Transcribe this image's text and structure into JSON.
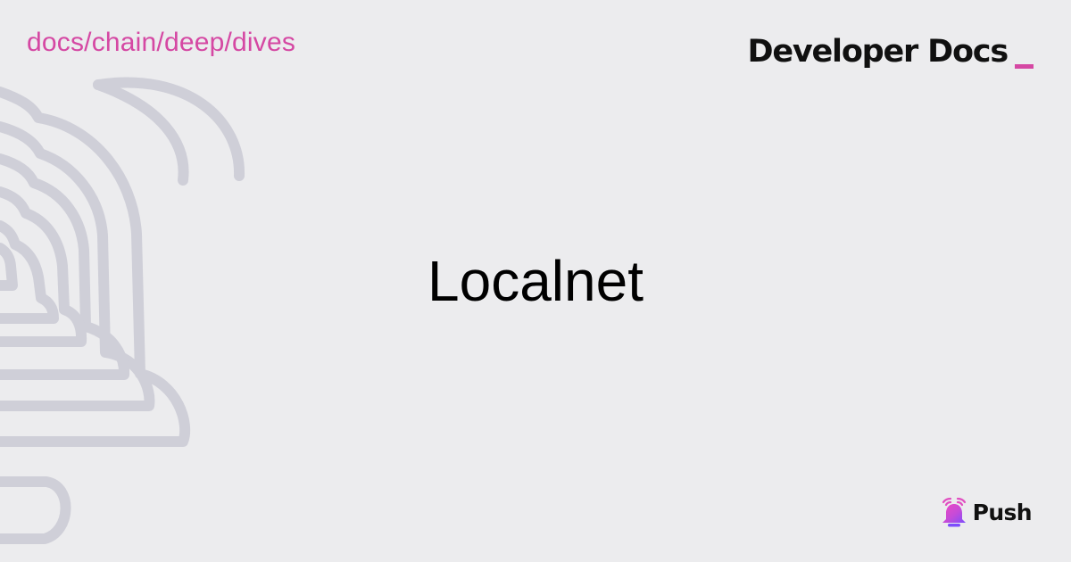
{
  "header": {
    "breadcrumb": "docs/chain/deep/dives",
    "brand_title": "Developer Docs"
  },
  "main": {
    "title": "Localnet"
  },
  "footer": {
    "logo_text": "Push"
  },
  "colors": {
    "background": "#ececee",
    "accent": "#d548a3",
    "text": "#000000",
    "decorative_outline": "#cfcfd8"
  },
  "icons": {
    "background": "bell-outline-icon",
    "logo": "push-bell-icon"
  }
}
